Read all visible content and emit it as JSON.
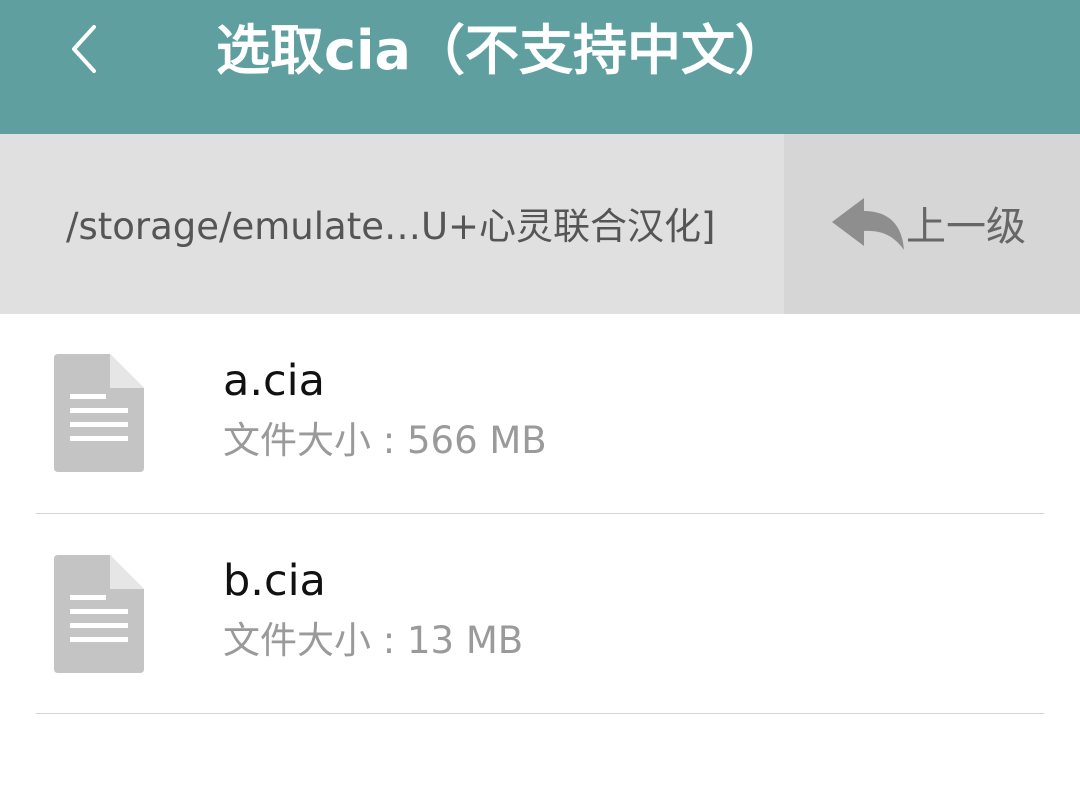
{
  "header": {
    "title": "选取cia（不支持中文）",
    "back_icon": "chevron-left-icon",
    "background_color": "#5f9fa0"
  },
  "path_bar": {
    "path": "/storage/emulate…U+心灵联合汉化]",
    "up_label": "上一级",
    "up_icon": "reply-arrow-icon"
  },
  "files": [
    {
      "name": "a.cia",
      "size_label": "文件大小 : 566 MB",
      "icon": "document-icon"
    },
    {
      "name": "b.cia",
      "size_label": "文件大小 : 13 MB",
      "icon": "document-icon"
    }
  ]
}
